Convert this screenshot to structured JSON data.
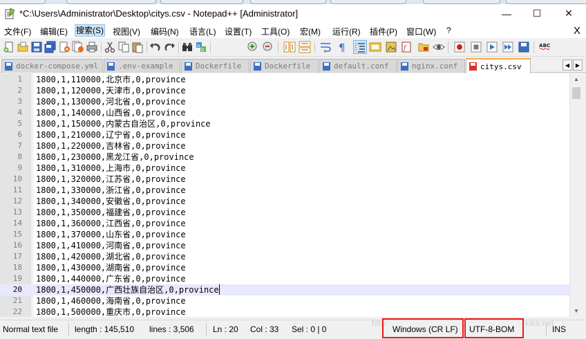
{
  "window": {
    "title": "*C:\\Users\\Administrator\\Desktop\\citys.csv - Notepad++ [Administrator]",
    "minimize": "—",
    "maximize": "☐",
    "close": "✕"
  },
  "menu": {
    "items": [
      "文件(F)",
      "编辑(E)",
      "搜索(S)",
      "视图(V)",
      "编码(N)",
      "语言(L)",
      "设置(T)",
      "工具(O)",
      "宏(M)",
      "运行(R)",
      "插件(P)",
      "窗口(W)",
      "?"
    ],
    "active_index": 2,
    "close_doc": "X"
  },
  "toolbar": {
    "icons": [
      "new-file",
      "open-file",
      "save",
      "save-all",
      "close",
      "close-all",
      "print",
      "cut",
      "copy",
      "paste",
      "undo",
      "redo",
      "find",
      "replace",
      "zoom-in",
      "zoom-out",
      "sync-vertical",
      "sync-horizontal",
      "word-wrap",
      "show-all-chars",
      "indent-guide",
      "user-language",
      "document-map",
      "function-list",
      "folder-as-workspace",
      "monitoring",
      "record-macro",
      "stop-record",
      "play-macro",
      "run-macro-multiple",
      "save-macro",
      "spell-check"
    ],
    "pressed_index": 20,
    "spell_label": "ABC"
  },
  "tabs": [
    {
      "label": "docker-compose.yml",
      "active": false
    },
    {
      "label": ".env-example",
      "active": false
    },
    {
      "label": "Dockerfile",
      "active": false
    },
    {
      "label": "Dockerfile",
      "active": false
    },
    {
      "label": "default.conf",
      "active": false
    },
    {
      "label": "nginx.conf",
      "active": false
    },
    {
      "label": "citys.csv",
      "active": true
    }
  ],
  "tab_nav": {
    "left": "◀",
    "right": "▶"
  },
  "editor": {
    "current_line": 20,
    "lines": [
      {
        "no": "1",
        "text": "1800,1,110000,北京市,0,province"
      },
      {
        "no": "2",
        "text": "1800,1,120000,天津市,0,province"
      },
      {
        "no": "3",
        "text": "1800,1,130000,河北省,0,province"
      },
      {
        "no": "4",
        "text": "1800,1,140000,山西省,0,province"
      },
      {
        "no": "5",
        "text": "1800,1,150000,内蒙古自治区,0,province"
      },
      {
        "no": "6",
        "text": "1800,1,210000,辽宁省,0,province"
      },
      {
        "no": "7",
        "text": "1800,1,220000,吉林省,0,province"
      },
      {
        "no": "8",
        "text": "1800,1,230000,黑龙江省,0,province"
      },
      {
        "no": "9",
        "text": "1800,1,310000,上海市,0,province"
      },
      {
        "no": "10",
        "text": "1800,1,320000,江苏省,0,province"
      },
      {
        "no": "11",
        "text": "1800,1,330000,浙江省,0,province"
      },
      {
        "no": "12",
        "text": "1800,1,340000,安徽省,0,province"
      },
      {
        "no": "13",
        "text": "1800,1,350000,福建省,0,province"
      },
      {
        "no": "14",
        "text": "1800,1,360000,江西省,0,province"
      },
      {
        "no": "15",
        "text": "1800,1,370000,山东省,0,province"
      },
      {
        "no": "16",
        "text": "1800,1,410000,河南省,0,province"
      },
      {
        "no": "17",
        "text": "1800,1,420000,湖北省,0,province"
      },
      {
        "no": "18",
        "text": "1800,1,430000,湖南省,0,province"
      },
      {
        "no": "19",
        "text": "1800,1,440000,广东省,0,province"
      },
      {
        "no": "20",
        "text": "1800,1,450000,广西壮族自治区,0,province"
      },
      {
        "no": "21",
        "text": "1800,1,460000,海南省,0,province"
      },
      {
        "no": "22",
        "text": "1800,1,500000,重庆市,0,province"
      }
    ]
  },
  "scrollbar": {
    "up": "▲",
    "down": "▼"
  },
  "status": {
    "file_type": "Normal text file",
    "length": "length : 145,510",
    "lines": "lines : 3,506",
    "ln": "Ln : 20",
    "col": "Col : 33",
    "sel": "Sel : 0 | 0",
    "eol": "Windows (CR LF)",
    "encoding": "UTF-8-BOM",
    "mode": "INS"
  },
  "colors": {
    "highlight_box": "#e51a1a",
    "current_line": "#e8e8ff",
    "active_tab_accent": "#f6a54b"
  }
}
